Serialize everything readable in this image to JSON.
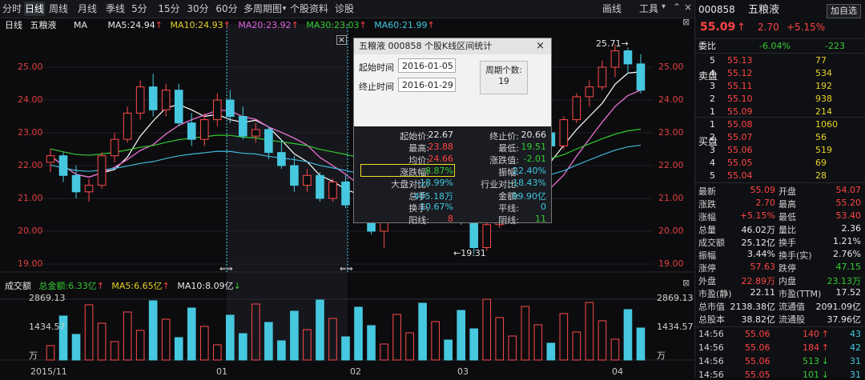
{
  "toolbar": {
    "tabs": [
      "分时",
      "日线",
      "周线",
      "月线",
      "季线",
      "5分",
      "15分",
      "30分",
      "60分",
      "多周期图",
      "个股资料",
      "诊股"
    ],
    "active_tab": "日线",
    "draw_label": "画线",
    "tools_label": "工具"
  },
  "stock": {
    "code": "000858",
    "name": "五粮液",
    "price": "55.09",
    "change": "2.70",
    "pct": "+5.15%",
    "add_button": "加自选"
  },
  "chart": {
    "period_label": "日线",
    "stock_label": "五粮液",
    "ma_label": "MA",
    "ma5": "MA5:24.94",
    "ma10": "MA10:24.93",
    "ma20": "MA20:23.92",
    "ma30": "MA30:23.03",
    "ma60": "MA60:21.99",
    "y_ticks_left": [
      "25.00",
      "24.00",
      "23.00",
      "22.00",
      "21.00",
      "20.00",
      "19.00"
    ],
    "y_ticks_right": [
      "25.00",
      "24.00",
      "23.00",
      "22.00",
      "21.00",
      "20.00",
      "19.00"
    ],
    "high_marker": "25.71→",
    "low_marker": "←19.31",
    "volume_title": "成交额",
    "vol_total": "总金额:6.33亿",
    "vol_ma5": "MA5:6.65亿",
    "vol_ma10": "MA10:8.09亿",
    "vol_ticks": [
      "2869.13",
      "1434.57",
      "万"
    ],
    "x_labels": [
      "2015/11",
      "01",
      "02",
      "03",
      "04"
    ]
  },
  "popup": {
    "title": "五粮液  000858  个股K线区间统计",
    "close": "×",
    "start_label": "起始时间",
    "start_value": "2016-01-05",
    "end_label": "终止时间",
    "end_value": "2016-01-29",
    "period_label": "周期个数:",
    "period_value": "19",
    "stats": [
      {
        "l1": "起始价:",
        "v1": "22.67",
        "l2": "终止价:",
        "v2": "20.66",
        "c1": "white",
        "c2": "white"
      },
      {
        "l1": "最高:",
        "v1": "23.88",
        "l2": "最低:",
        "v2": "19.51",
        "c1": "red",
        "c2": "green"
      },
      {
        "l1": "均价:",
        "v1": "24.66",
        "l2": "涨跌值:",
        "v2": "-2.01",
        "c1": "red",
        "c2": "green"
      },
      {
        "l1": "涨跌幅:",
        "v1": "-8.87%",
        "l2": "振幅:",
        "v2": "22.40%",
        "c1": "green",
        "c2": "cyan"
      },
      {
        "l1": "大盘对比:",
        "v1": "-18.99%",
        "l2": "行业对比:",
        "v2": "-18.43%",
        "c1": "cyan",
        "c2": "cyan"
      },
      {
        "l1": "总手:",
        "v1": "405.18万",
        "l2": "金额:",
        "v2": "99.90亿",
        "c1": "cyan",
        "c2": "cyan"
      },
      {
        "l1": "换手:",
        "v1": "10.67%",
        "l2": "平线:",
        "v2": "0",
        "c1": "cyan",
        "c2": "cyan"
      },
      {
        "l1": "阳线:",
        "v1": "8",
        "l2": "阴线:",
        "v2": "11",
        "c1": "red",
        "c2": "green"
      }
    ]
  },
  "orderbook": {
    "wb_label": "委比",
    "wb_value": "-6.04%",
    "wc_value": "-223",
    "sell_label": "卖盘",
    "buy_label": "买盘",
    "sell": [
      [
        "5",
        "55.13",
        "77"
      ],
      [
        "4",
        "55.12",
        "534"
      ],
      [
        "3",
        "55.11",
        "192"
      ],
      [
        "2",
        "55.10",
        "938"
      ],
      [
        "1",
        "55.09",
        "214"
      ]
    ],
    "buy": [
      [
        "1",
        "55.08",
        "1060"
      ],
      [
        "2",
        "55.07",
        "56"
      ],
      [
        "3",
        "55.06",
        "519"
      ],
      [
        "4",
        "55.05",
        "69"
      ],
      [
        "5",
        "55.04",
        "28"
      ]
    ]
  },
  "quote": [
    [
      "最新",
      "55.09",
      "开盘",
      "54.07",
      "red",
      "red"
    ],
    [
      "涨跌",
      "2.70",
      "最高",
      "55.20",
      "red",
      "red"
    ],
    [
      "涨幅",
      "+5.15%",
      "最低",
      "53.40",
      "red",
      "red"
    ],
    [
      "总量",
      "46.02万",
      "量比",
      "2.36",
      "white",
      "white"
    ],
    [
      "成交额",
      "25.12亿",
      "换手",
      "1.21%",
      "white",
      "white"
    ],
    [
      "振幅",
      "3.44%",
      "换手(实)",
      "2.76%",
      "white",
      "white"
    ],
    [
      "涨停",
      "57.63",
      "跌停",
      "47.15",
      "red",
      "green"
    ],
    [
      "外盘",
      "22.89万",
      "内盘",
      "23.13万",
      "red",
      "green"
    ],
    [
      "市盈(静)",
      "22.11",
      "市盈(TTM)",
      "17.52",
      "white",
      "white"
    ],
    [
      "总市值",
      "2138.38亿",
      "流通值",
      "2091.09亿",
      "white",
      "white"
    ],
    [
      "总股本",
      "38.82亿",
      "流通股",
      "37.96亿",
      "white",
      "white"
    ]
  ],
  "ticks": [
    [
      "14:56",
      "55.06",
      "140",
      "↑",
      "43",
      "red",
      "red",
      "cyan"
    ],
    [
      "14:56",
      "55.06",
      "184",
      "↑",
      "42",
      "red",
      "red",
      "cyan"
    ],
    [
      "14:56",
      "55.06",
      "513",
      "↓",
      "31",
      "red",
      "green",
      "cyan"
    ],
    [
      "14:56",
      "55.05",
      "101",
      "↓",
      "31",
      "red",
      "green",
      "cyan"
    ]
  ],
  "chart_data": {
    "type": "candlestick",
    "x_labels": [
      "2015/11",
      "01",
      "02",
      "03",
      "04"
    ],
    "ylim": [
      19,
      25.8
    ],
    "series": [
      {
        "name": "MA5",
        "value": 24.94,
        "color": "#ffffff"
      },
      {
        "name": "MA10",
        "value": 24.93,
        "color": "#e6d22a"
      },
      {
        "name": "MA20",
        "value": 23.92,
        "color": "#e060e0"
      },
      {
        "name": "MA30",
        "value": 23.03,
        "color": "#33cc33"
      },
      {
        "name": "MA60",
        "value": 21.99,
        "color": "#40b8d8"
      }
    ],
    "candles": [
      [
        22.1,
        22.5,
        21.8,
        22.3
      ],
      [
        22.3,
        22.4,
        21.5,
        21.7
      ],
      [
        21.7,
        22.0,
        21.0,
        21.2
      ],
      [
        21.2,
        21.6,
        20.9,
        21.4
      ],
      [
        21.4,
        22.4,
        21.3,
        22.3
      ],
      [
        22.3,
        23.0,
        22.1,
        22.8
      ],
      [
        22.8,
        23.8,
        22.7,
        23.6
      ],
      [
        23.6,
        24.6,
        23.4,
        24.4
      ],
      [
        24.4,
        24.8,
        23.5,
        23.7
      ],
      [
        23.7,
        24.5,
        23.5,
        24.3
      ],
      [
        24.3,
        24.5,
        23.2,
        23.3
      ],
      [
        23.3,
        23.6,
        22.6,
        22.8
      ],
      [
        22.8,
        23.6,
        22.6,
        23.4
      ],
      [
        23.4,
        24.2,
        23.2,
        24.0
      ],
      [
        24.0,
        24.3,
        23.3,
        23.5
      ],
      [
        23.5,
        23.8,
        22.8,
        22.9
      ],
      [
        22.9,
        23.3,
        22.7,
        23.1
      ],
      [
        23.1,
        23.2,
        22.2,
        22.4
      ],
      [
        22.4,
        22.8,
        21.9,
        22.0
      ],
      [
        22.0,
        22.3,
        21.2,
        21.4
      ],
      [
        21.4,
        21.9,
        21.2,
        21.7
      ],
      [
        21.7,
        21.8,
        20.9,
        21.0
      ],
      [
        21.0,
        21.6,
        20.9,
        21.5
      ],
      [
        21.5,
        21.7,
        20.7,
        20.8
      ],
      [
        20.8,
        21.1,
        20.4,
        20.6
      ],
      [
        20.6,
        20.8,
        19.9,
        20.0
      ],
      [
        20.0,
        20.6,
        19.5,
        20.5
      ],
      [
        20.5,
        20.9,
        20.4,
        20.7
      ],
      [
        20.7,
        21.2,
        20.5,
        21.0
      ],
      [
        21.0,
        21.3,
        20.6,
        20.7
      ],
      [
        20.7,
        21.5,
        20.6,
        21.4
      ],
      [
        21.4,
        21.6,
        20.8,
        20.9
      ],
      [
        20.9,
        21.1,
        20.2,
        20.3
      ],
      [
        20.3,
        20.5,
        19.3,
        19.5
      ],
      [
        19.5,
        20.3,
        19.4,
        20.2
      ],
      [
        20.2,
        21.0,
        20.1,
        20.9
      ],
      [
        20.9,
        21.8,
        20.8,
        21.7
      ],
      [
        21.7,
        22.5,
        21.6,
        22.4
      ],
      [
        22.4,
        23.2,
        22.3,
        23.0
      ],
      [
        23.0,
        23.3,
        22.5,
        22.6
      ],
      [
        22.6,
        23.5,
        22.5,
        23.4
      ],
      [
        23.4,
        24.2,
        23.3,
        24.1
      ],
      [
        24.1,
        24.6,
        23.8,
        24.4
      ],
      [
        24.4,
        25.2,
        24.3,
        25.0
      ],
      [
        25.0,
        25.7,
        24.7,
        25.5
      ],
      [
        25.5,
        25.6,
        24.8,
        25.1
      ],
      [
        25.1,
        25.4,
        24.2,
        24.3
      ]
    ]
  }
}
